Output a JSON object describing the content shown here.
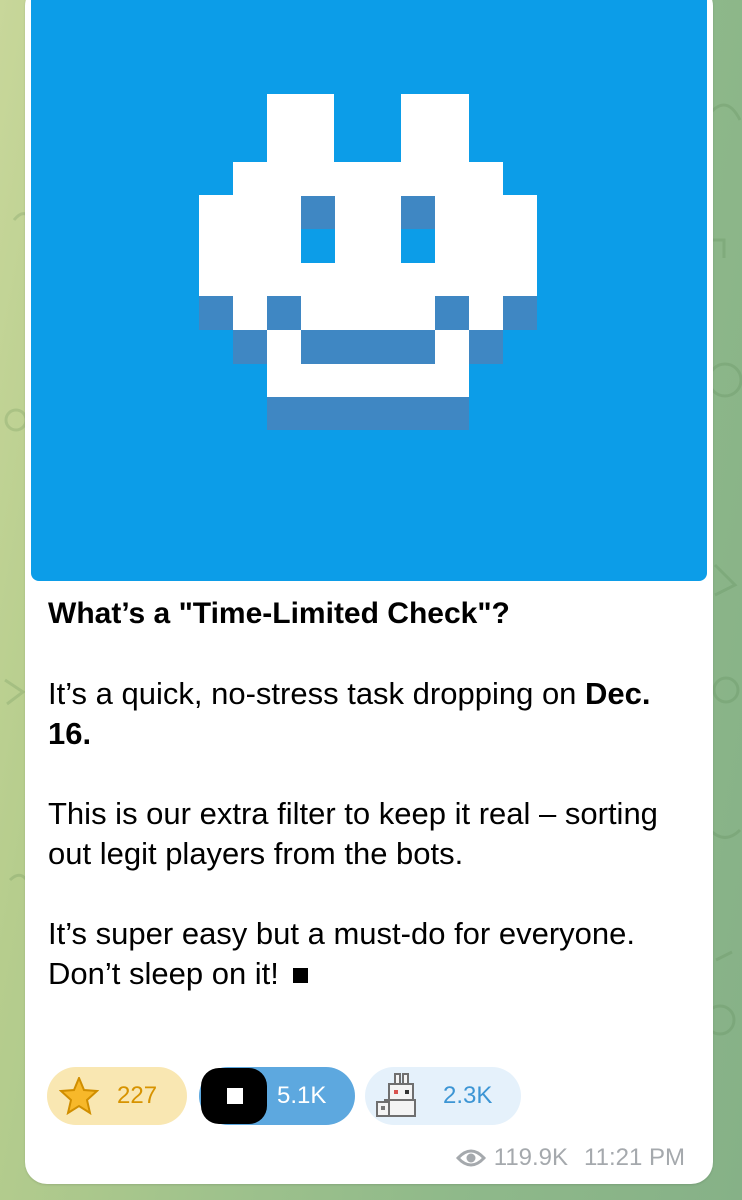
{
  "post": {
    "heading": "What’s a \"Time-Limited Check\"?",
    "line1_text": "It’s a quick, no-stress task dropping on ",
    "line1_bold": "Dec. 16.",
    "paragraph2": "This is our extra filter to keep it real – sorting out legit players from the bots.",
    "paragraph3": "It’s super easy but a must-do for everyone. Don’t sleep on it!"
  },
  "reactions": [
    {
      "icon": "star-icon",
      "count": "227"
    },
    {
      "icon": "black-square-avatar",
      "count": "5.1K"
    },
    {
      "icon": "rabbit-sticker-icon",
      "count": "2.3K"
    }
  ],
  "meta": {
    "views": "119.9K",
    "time": "11:21 PM"
  },
  "colors": {
    "media_background": "#0c9de8",
    "pixel_white": "#ffffff",
    "pixel_shadow": "#3f87c3",
    "star_reaction_bg": "#f9e7b2",
    "square_reaction_bg": "#5da8df",
    "rabbit_reaction_bg": "#e5f1fb"
  }
}
